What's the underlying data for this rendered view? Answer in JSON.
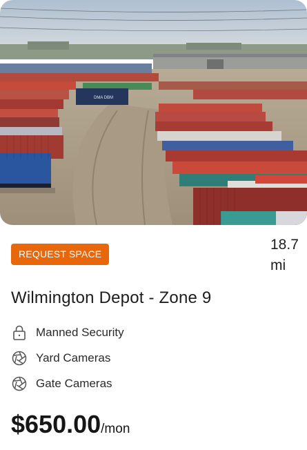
{
  "listing": {
    "cta_label": "REQUEST SPACE",
    "distance_value": "18.7",
    "distance_unit": "mi",
    "title": "Wilmington Depot - Zone 9",
    "features": [
      {
        "label": "Manned Security",
        "icon": "lock-icon"
      },
      {
        "label": "Yard Cameras",
        "icon": "camera-aperture-icon"
      },
      {
        "label": "Gate Cameras",
        "icon": "camera-aperture-icon"
      }
    ],
    "price_amount": "$650.00",
    "price_unit": "/mon",
    "photo_trailer_text": "DMA DBM"
  },
  "colors": {
    "accent": "#e9670b",
    "text": "#1f1f1f",
    "icon": "#555555"
  }
}
